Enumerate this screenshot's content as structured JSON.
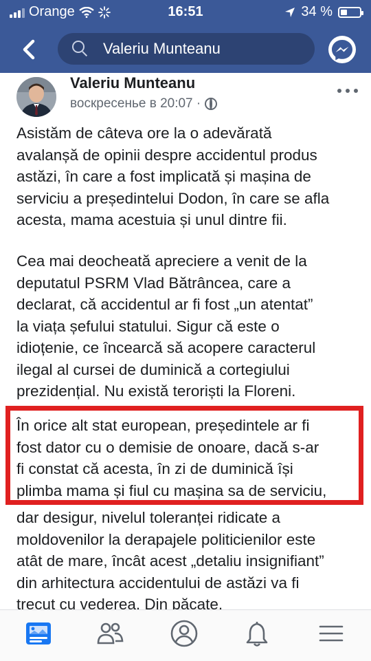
{
  "status_bar": {
    "carrier": "Orange",
    "time": "16:51",
    "battery_percent": "34 %",
    "battery_level": 0.34
  },
  "header": {
    "search_text": "Valeriu Munteanu",
    "back_icon": "chevron-left-icon",
    "messenger_icon": "messenger-icon"
  },
  "post": {
    "author": "Valeriu Munteanu",
    "timestamp": "воскресенье в 20:07 ·",
    "paragraphs": [
      [
        "Asistăm de câteva ore la o adevărată",
        "avalanșă de opinii despre accidentul produs",
        "astăzi, în care a fost implicată și mașina de",
        "serviciu a președintelui Dodon, în care se afla",
        "acesta, mama acestuia și unul dintre fii."
      ],
      [
        "Cea mai deocheată apreciere a venit de la",
        "deputatul PSRM Vlad Bătrâncea, care a",
        "declarat, că accidentul ar fi fost „un atentat”",
        "la viața șefului statului. Sigur că este o",
        "idioțenie, ce încearcă să acopere caracterul",
        "ilegal al cursei de duminică a cortegiului",
        "prezidențial. Nu există teroriști la Floreni."
      ],
      [
        "În orice alt stat european, președintele ar fi",
        "fost dator cu o demisie de onoare, dacă s-ar",
        "fi constat că acesta, în zi de duminică își",
        "plimba mama și fiul cu mașina sa de serviciu,"
      ],
      [
        "dar desigur, nivelul toleranței ridicate a",
        "moldovenilor la derapajele politicienilor este",
        "atât de mare, încât acest „detaliu insignifiant”",
        "din arhitectura accidentului de astăzi va fi",
        "trecut cu vederea. Din păcate."
      ]
    ],
    "highlight_color": "#e02020"
  },
  "colors": {
    "brand": "#3b5998",
    "search_bg": "#2d4373",
    "active_tab": "#1877f2",
    "inactive_tab": "#606770"
  },
  "bottom_nav": [
    {
      "icon": "news-feed-icon",
      "active": true
    },
    {
      "icon": "friends-icon",
      "active": false
    },
    {
      "icon": "profile-icon",
      "active": false
    },
    {
      "icon": "notifications-bell-icon",
      "active": false
    },
    {
      "icon": "menu-icon",
      "active": false
    }
  ]
}
